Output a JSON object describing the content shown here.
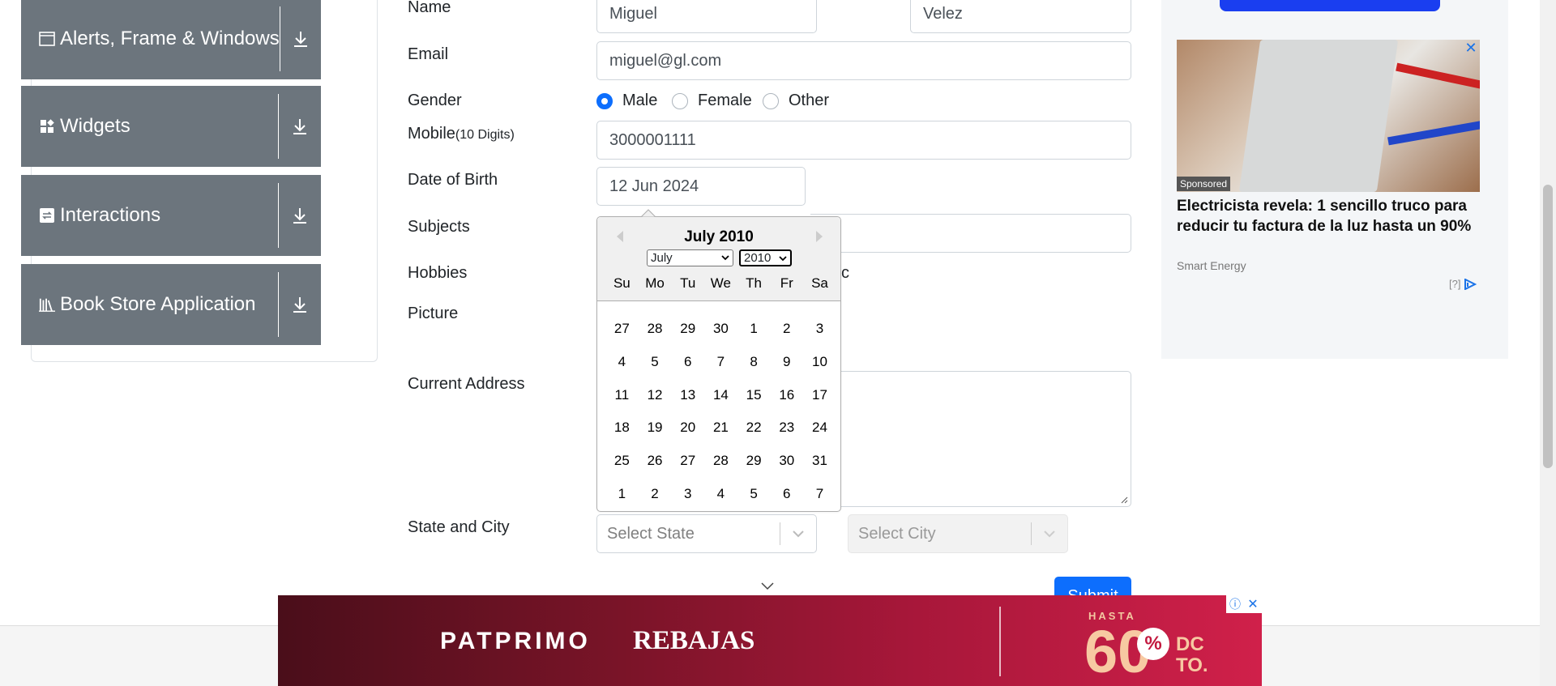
{
  "sidebar": {
    "groups": [
      {
        "label": "Alerts, Frame & Windows",
        "icon": "window-icon"
      },
      {
        "label": "Widgets",
        "icon": "widgets-icon"
      },
      {
        "label": "Interactions",
        "icon": "interactions-icon"
      },
      {
        "label": "Book Store Application",
        "icon": "books-icon"
      }
    ]
  },
  "form": {
    "name_label": "Name",
    "first_name": "Miguel",
    "last_name": "Velez",
    "email_label": "Email",
    "email": "miguel@gl.com",
    "gender_label": "Gender",
    "gender_options": [
      "Male",
      "Female",
      "Other"
    ],
    "gender_selected": "Male",
    "mobile_label": "Mobile",
    "mobile_hint": "(10 Digits)",
    "mobile": "3000001111",
    "dob_label": "Date of Birth",
    "dob": "12 Jun 2024",
    "subjects_label": "Subjects",
    "hobbies_label": "Hobbies",
    "hobbies_partial": "c",
    "picture_label": "Picture",
    "address_label": "Current Address",
    "state_city_label": "State and City",
    "state_placeholder": "Select State",
    "city_placeholder": "Select City",
    "submit_label": "Submit"
  },
  "datepicker": {
    "title": "July 2010",
    "month_select": "July",
    "year_select": "2010",
    "weekdays": [
      "Su",
      "Mo",
      "Tu",
      "We",
      "Th",
      "Fr",
      "Sa"
    ],
    "weeks": [
      [
        "27",
        "28",
        "29",
        "30",
        "1",
        "2",
        "3"
      ],
      [
        "4",
        "5",
        "6",
        "7",
        "8",
        "9",
        "10"
      ],
      [
        "11",
        "12",
        "13",
        "14",
        "15",
        "16",
        "17"
      ],
      [
        "18",
        "19",
        "20",
        "21",
        "22",
        "23",
        "24"
      ],
      [
        "25",
        "26",
        "27",
        "28",
        "29",
        "30",
        "31"
      ],
      [
        "1",
        "2",
        "3",
        "4",
        "5",
        "6",
        "7"
      ]
    ]
  },
  "ad_right": {
    "sponsored": "Sponsored",
    "headline": "Electricista revela: 1 sencillo truco para reducir tu factura de la luz hasta un 90%",
    "brand": "Smart Energy",
    "info": "[?]"
  },
  "banner": {
    "brand": "PATPRIMO",
    "sale": "REBAJAS",
    "hasta": "HASTA",
    "big": "60",
    "pct": "%",
    "dcto_line1": "DC",
    "dcto_line2": "TO."
  },
  "colors": {
    "sidebar_group_bg": "#6c757d",
    "primary": "#0d6efd",
    "banner_start": "#4a0e1a",
    "banner_end": "#d0204a"
  }
}
